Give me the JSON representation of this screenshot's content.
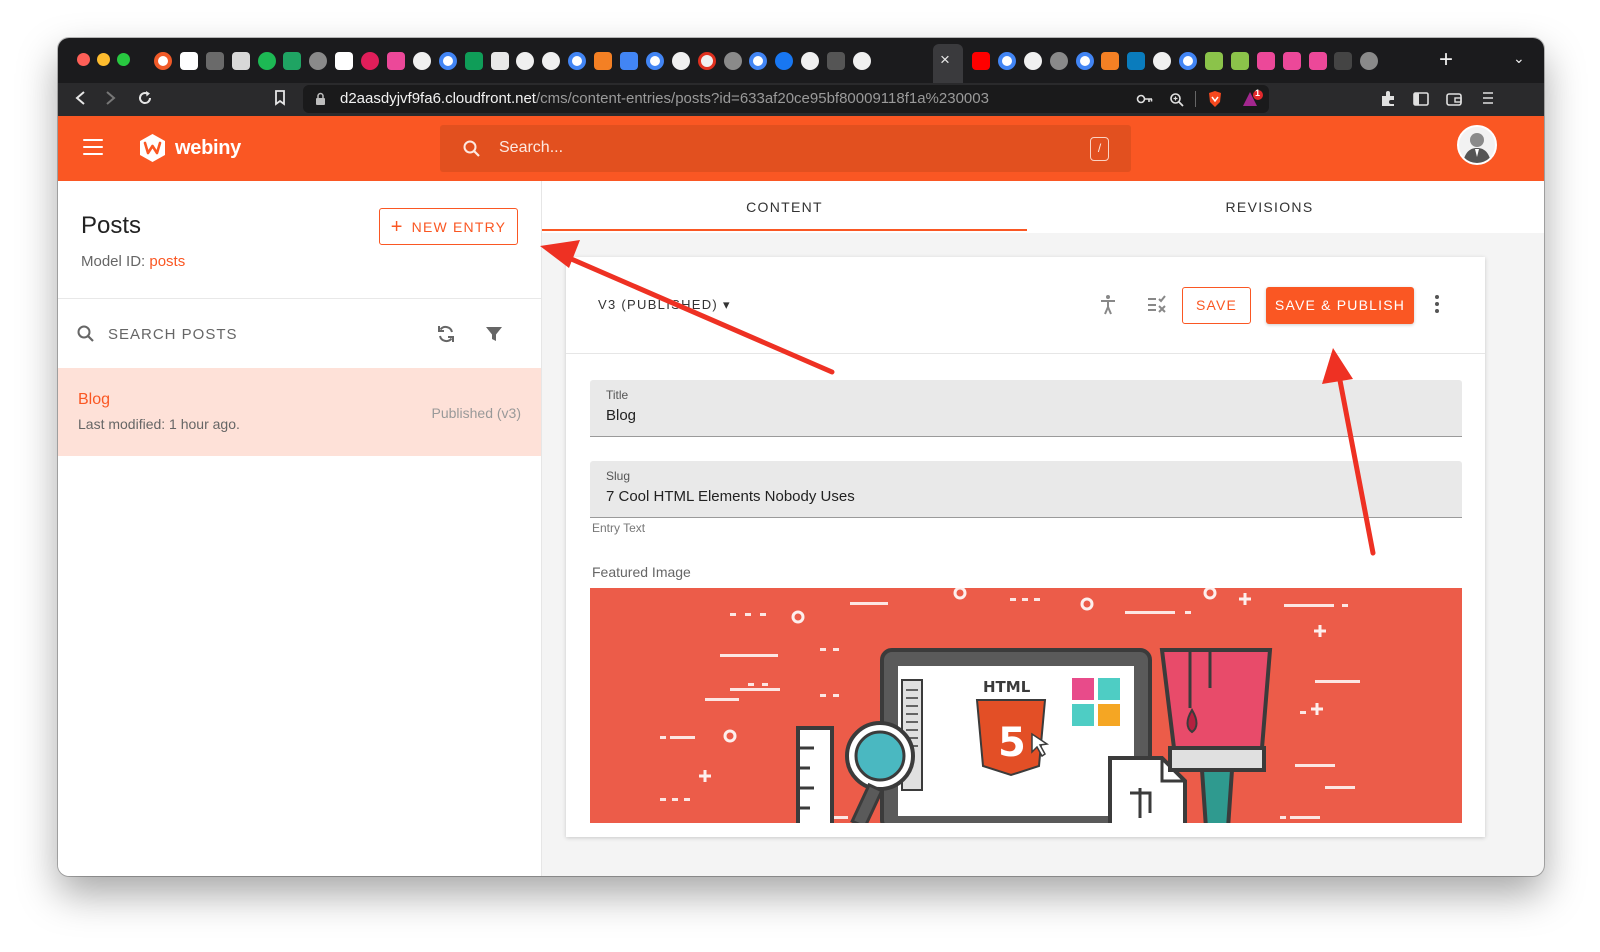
{
  "browser": {
    "url_host": "d2aasdyjvf9fa6.cloudfront.net",
    "url_path": "/cms/content-entries/posts?id=633af20ce95bf80009118f1a%230003",
    "tab_close_glyph": "×",
    "new_tab_glyph": "+",
    "tab_menu_glyph": "⌄",
    "extension_badge": "1"
  },
  "header": {
    "logo_text": "webiny",
    "search_placeholder": "Search...",
    "search_shortcut": "/"
  },
  "sidebar": {
    "title": "Posts",
    "model_id_label": "Model ID: ",
    "model_id_value": "posts",
    "new_entry_icon": "+",
    "new_entry_label": "NEW ENTRY",
    "search_label": "SEARCH POSTS",
    "entries": [
      {
        "title": "Blog",
        "modified": "Last modified: 1 hour ago.",
        "status": "Published (v3)"
      }
    ]
  },
  "tabs": [
    {
      "label": "CONTENT",
      "active": true
    },
    {
      "label": "REVISIONS",
      "active": false
    }
  ],
  "editor": {
    "version_label": "V3 (PUBLISHED)",
    "version_caret": "▾",
    "save_label": "SAVE",
    "publish_label": "SAVE & PUBLISH",
    "fields": [
      {
        "label": "Title",
        "value": "Blog"
      },
      {
        "label": "Slug",
        "value": "7 Cool HTML Elements Nobody Uses"
      }
    ],
    "helper_text": "Entry Text",
    "featured_image_label": "Featured Image",
    "featured_image_text": "HTML",
    "featured_image_badge": "5"
  },
  "colors": {
    "brand": "#fa5723",
    "selected_row": "#fee1d8",
    "annotation_arrow": "#ee3123",
    "image_bg": "#ec5c49"
  },
  "icons": [
    "hamburger-icon",
    "webiny-logo-icon",
    "search-icon",
    "refresh-icon",
    "filter-icon",
    "accessibility-icon",
    "checklist-icon",
    "more-vert-icon"
  ]
}
